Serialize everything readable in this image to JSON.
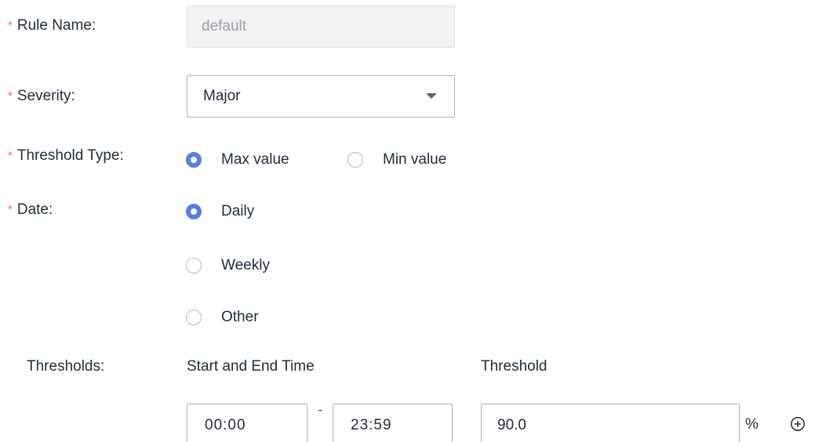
{
  "form": {
    "required_mark": "*",
    "rule_name": {
      "label": "Rule Name:",
      "value": "default"
    },
    "severity": {
      "label": "Severity:",
      "value": "Major"
    },
    "threshold_type": {
      "label": "Threshold Type:",
      "options": [
        {
          "label": "Max value",
          "checked": true
        },
        {
          "label": "Min value",
          "checked": false
        }
      ]
    },
    "date": {
      "label": "Date:",
      "options": [
        {
          "label": "Daily",
          "checked": true
        },
        {
          "label": "Weekly",
          "checked": false
        },
        {
          "label": "Other",
          "checked": false
        }
      ]
    },
    "thresholds": {
      "label": "Thresholds:",
      "col_time": "Start and End Time",
      "col_threshold": "Threshold",
      "start_time": "00:00",
      "separator": "-",
      "end_time": "23:59",
      "threshold_value": "90.0",
      "unit": "%"
    }
  },
  "colors": {
    "accent": "#5e7ce0",
    "required": "#f66f6a"
  },
  "icons": {
    "add": "plus-circle-icon",
    "dropdown": "chevron-down-icon"
  }
}
